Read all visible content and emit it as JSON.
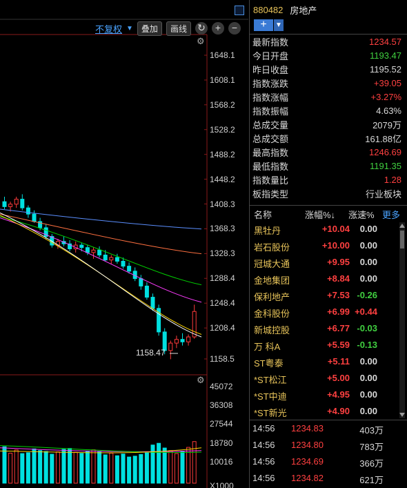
{
  "toolbar": {
    "fq_label": "不复权",
    "overlay_label": "叠加",
    "draw_label": "画线",
    "refresh_icon": "refresh-icon",
    "zoom_in": "+",
    "zoom_out": "−"
  },
  "price_axis": [
    "1648.1",
    "1608.1",
    "1568.2",
    "1528.2",
    "1488.2",
    "1448.2",
    "1408.3",
    "1368.3",
    "1328.3",
    "1288.4",
    "1248.4",
    "1208.4",
    "1158.5"
  ],
  "volume_axis": [
    "45072",
    "36308",
    "27544",
    "18780",
    "10016",
    "X1000"
  ],
  "min_price_label": "1158.47",
  "colors": {
    "up": "#ff3b3b",
    "down": "#00e0e0",
    "ma5": "#ffffff",
    "ma10": "#ffd700",
    "ma20": "#ff3cff",
    "ma30": "#00d000",
    "ma60": "#ff7040",
    "ma120": "#5b8fff",
    "accent": "#e8c45a"
  },
  "chart_data": {
    "type": "candlestick",
    "y_range": [
      1158.5,
      1648.1
    ],
    "candles": [
      [
        1412,
        1420,
        1400,
        1404
      ],
      [
        1404,
        1412,
        1396,
        1408
      ],
      [
        1408,
        1420,
        1402,
        1416
      ],
      [
        1416,
        1424,
        1398,
        1402
      ],
      [
        1402,
        1406,
        1386,
        1392
      ],
      [
        1392,
        1398,
        1378,
        1380
      ],
      [
        1380,
        1386,
        1366,
        1370
      ],
      [
        1370,
        1376,
        1352,
        1356
      ],
      [
        1356,
        1360,
        1338,
        1342
      ],
      [
        1342,
        1352,
        1336,
        1348
      ],
      [
        1348,
        1356,
        1340,
        1344
      ],
      [
        1344,
        1350,
        1332,
        1336
      ],
      [
        1336,
        1348,
        1330,
        1342
      ],
      [
        1342,
        1346,
        1332,
        1338
      ],
      [
        1338,
        1342,
        1326,
        1330
      ],
      [
        1330,
        1338,
        1320,
        1334
      ],
      [
        1334,
        1340,
        1322,
        1326
      ],
      [
        1326,
        1334,
        1316,
        1318
      ],
      [
        1318,
        1326,
        1312,
        1322
      ],
      [
        1322,
        1328,
        1312,
        1316
      ],
      [
        1316,
        1322,
        1304,
        1308
      ],
      [
        1308,
        1314,
        1296,
        1300
      ],
      [
        1300,
        1306,
        1284,
        1288
      ],
      [
        1288,
        1294,
        1270,
        1276
      ],
      [
        1276,
        1282,
        1254,
        1258
      ],
      [
        1258,
        1264,
        1236,
        1240
      ],
      [
        1240,
        1246,
        1196,
        1202
      ],
      [
        1202,
        1208,
        1166,
        1172
      ],
      [
        1172,
        1188,
        1158,
        1184
      ],
      [
        1184,
        1196,
        1176,
        1190
      ],
      [
        1190,
        1200,
        1180,
        1186
      ],
      [
        1186,
        1198,
        1180,
        1194
      ],
      [
        1194,
        1246,
        1191,
        1235
      ]
    ],
    "ma": {
      "ma120": [
        1400,
        1368
      ],
      "ma60": [
        1392,
        1328
      ],
      "ma30": [
        1388,
        1278
      ],
      "ma20": [
        1386,
        1250
      ],
      "ma10": [
        1390,
        1198
      ],
      "ma5": [
        1394,
        1194
      ]
    },
    "volume_range": [
      0,
      45072
    ],
    "volumes": [
      17000,
      14000,
      15500,
      13800,
      14200,
      16000,
      15200,
      14800,
      13500,
      14600,
      15800,
      16200,
      14400,
      13900,
      15000,
      15600,
      14800,
      13200,
      14000,
      12800,
      13600,
      12200,
      12600,
      13400,
      14100,
      17800,
      18600,
      16400,
      15200,
      13800,
      14900,
      16700,
      19400
    ]
  },
  "panel": {
    "code": "880482",
    "name": "房地产",
    "quotes": [
      {
        "k": "最新指数",
        "v": "1234.57",
        "c": "#ff4040"
      },
      {
        "k": "今日开盘",
        "v": "1193.47",
        "c": "#40d040"
      },
      {
        "k": "昨日收盘",
        "v": "1195.52",
        "c": "#d8d8d8"
      },
      {
        "k": "指数涨跌",
        "v": "+39.05",
        "c": "#ff4040"
      },
      {
        "k": "指数涨幅",
        "v": "+3.27%",
        "c": "#ff4040"
      },
      {
        "k": "指数振幅",
        "v": "4.63%",
        "c": "#d8d8d8"
      },
      {
        "k": "总成交量",
        "v": "2079万",
        "c": "#d8d8d8"
      },
      {
        "k": "总成交额",
        "v": "161.88亿",
        "c": "#d8d8d8"
      },
      {
        "k": "最高指数",
        "v": "1246.69",
        "c": "#ff4040"
      },
      {
        "k": "最低指数",
        "v": "1191.35",
        "c": "#40d040"
      },
      {
        "k": "指数量比",
        "v": "1.28",
        "c": "#ff4040"
      },
      {
        "k": "板指类型",
        "v": "行业板块",
        "c": "#d8d8d8"
      }
    ],
    "list_header": {
      "name": "名称",
      "pct": "涨幅%↓",
      "speed": "涨速%",
      "more": "更多"
    },
    "stocks": [
      {
        "name": "黑牡丹",
        "pct": "+10.04",
        "speed": "0.00",
        "sc": "#d8d8d8"
      },
      {
        "name": "岩石股份",
        "pct": "+10.00",
        "speed": "0.00",
        "sc": "#d8d8d8"
      },
      {
        "name": "冠城大通",
        "pct": "+9.95",
        "speed": "0.00",
        "sc": "#d8d8d8"
      },
      {
        "name": "金地集团",
        "pct": "+8.84",
        "speed": "0.00",
        "sc": "#d8d8d8"
      },
      {
        "name": "保利地产",
        "pct": "+7.53",
        "speed": "-0.26",
        "sc": "#40d040"
      },
      {
        "name": "金科股份",
        "pct": "+6.99",
        "speed": "+0.44",
        "sc": "#ff4040"
      },
      {
        "name": "新城控股",
        "pct": "+6.77",
        "speed": "-0.03",
        "sc": "#40d040"
      },
      {
        "name": "万 科A",
        "pct": "+5.59",
        "speed": "-0.13",
        "sc": "#40d040"
      },
      {
        "name": "ST粤泰",
        "pct": "+5.11",
        "speed": "0.00",
        "sc": "#d8d8d8"
      },
      {
        "name": "*ST松江",
        "pct": "+5.00",
        "speed": "0.00",
        "sc": "#d8d8d8"
      },
      {
        "name": "*ST中迪",
        "pct": "+4.95",
        "speed": "0.00",
        "sc": "#d8d8d8"
      },
      {
        "name": "*ST新光",
        "pct": "+4.90",
        "speed": "0.00",
        "sc": "#d8d8d8"
      }
    ],
    "ticks": [
      {
        "t": "14:56",
        "p": "1234.83",
        "v": "403万"
      },
      {
        "t": "14:56",
        "p": "1234.80",
        "v": "783万"
      },
      {
        "t": "14:56",
        "p": "1234.69",
        "v": "366万"
      },
      {
        "t": "14:56",
        "p": "1234.82",
        "v": "621万"
      }
    ]
  }
}
